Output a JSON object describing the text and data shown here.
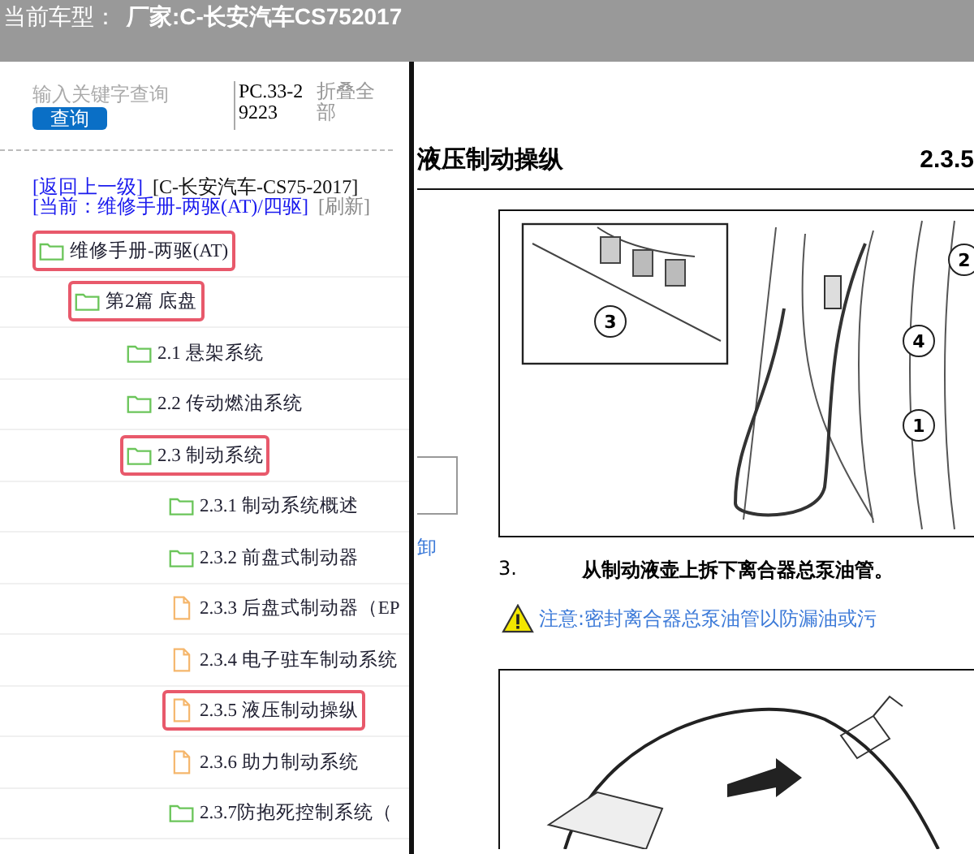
{
  "header": {
    "label": "当前车型：",
    "value": "厂家:C-长安汽车CS752017"
  },
  "search": {
    "placeholder": "输入关键字查询",
    "button": "查询"
  },
  "part_code": "PC.33-29223",
  "collapse_all": "折叠全部",
  "nav": {
    "back": "[返回上一级]",
    "model": "[C-长安汽车-CS75-2017]",
    "current": "[当前：维修手册-两驱(AT)/四驱]",
    "refresh": "[刷新]"
  },
  "tree": [
    {
      "label": "维修手册-两驱(AT)",
      "kind": "folder",
      "highlighted": true,
      "children": [
        {
          "label": "第2篇 底盘",
          "kind": "folder",
          "highlighted": true,
          "children": [
            {
              "label": "2.1 悬架系统",
              "kind": "folder",
              "highlighted": false
            },
            {
              "label": "2.2 传动燃油系统",
              "kind": "folder",
              "highlighted": false
            },
            {
              "label": "2.3 制动系统",
              "kind": "folder",
              "highlighted": true,
              "children": [
                {
                  "label": "2.3.1 制动系统概述",
                  "kind": "folder",
                  "highlighted": false
                },
                {
                  "label": "2.3.2 前盘式制动器",
                  "kind": "folder",
                  "highlighted": false
                },
                {
                  "label": "2.3.3 后盘式制动器（EP",
                  "kind": "page",
                  "highlighted": false
                },
                {
                  "label": "2.3.4 电子驻车制动系统",
                  "kind": "page",
                  "highlighted": false
                },
                {
                  "label": "2.3.5 液压制动操纵",
                  "kind": "page",
                  "highlighted": true
                },
                {
                  "label": "2.3.6 助力制动系统",
                  "kind": "page",
                  "highlighted": false
                },
                {
                  "label": "2.3.7防抱死控制系统（",
                  "kind": "folder",
                  "highlighted": false
                }
              ]
            }
          ]
        }
      ]
    }
  ],
  "document": {
    "title": "液压制动操纵",
    "section": "2.3.5",
    "side_text": "卸",
    "callouts": [
      "3",
      "2",
      "4",
      "1"
    ],
    "step": {
      "number": "3.",
      "text": "从制动液壶上拆下离合器总泵油管。"
    },
    "caution": "注意:密封离合器总泵油管以防漏油或污"
  }
}
